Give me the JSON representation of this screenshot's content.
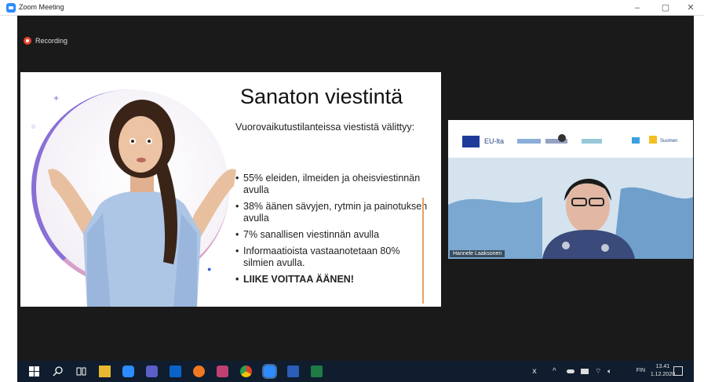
{
  "window": {
    "title": "Zoom Meeting",
    "controls": {
      "minimize": "–",
      "maximize": "▢",
      "close": "✕"
    }
  },
  "recording": {
    "label": "Recording"
  },
  "slide": {
    "title": "Sanaton viestintä",
    "intro": "Vuorovaikutustilanteissa viestistä välittyy:",
    "bullets": [
      "55% eleiden, ilmeiden ja oheisviestinnän avulla",
      "38% äänen sävyjen, rytmin ja painotuksen avulla",
      "7% sanallisen viestinnän avulla",
      "Informaatioista vastaanotetaan 80% silmien avulla.",
      "LIIKE VOITTAA ÄÄNEN!"
    ]
  },
  "video": {
    "participant_name": "Hannele Laaksonen",
    "logos": {
      "eu": "EU-lta",
      "right": "Suomen"
    }
  },
  "taskbar": {
    "language": "FIN",
    "time": "13.41",
    "date": "1.12.2020",
    "apps": [
      "windows-icon",
      "search-icon",
      "task-view-icon",
      "file-explorer-icon",
      "zoom-taskbar-icon",
      "teams-icon",
      "outlook-icon",
      "firefox-icon",
      "snip-icon",
      "chrome-icon",
      "zoom-active-icon",
      "word-icon",
      "excel-icon"
    ]
  },
  "colors": {
    "zoom_blue": "#2d8cff",
    "recording_red": "#e8452e",
    "taskbar_bg": "#0f1d2e",
    "meeting_bg": "#1a1a1a",
    "accent_line": "#e8a060"
  }
}
